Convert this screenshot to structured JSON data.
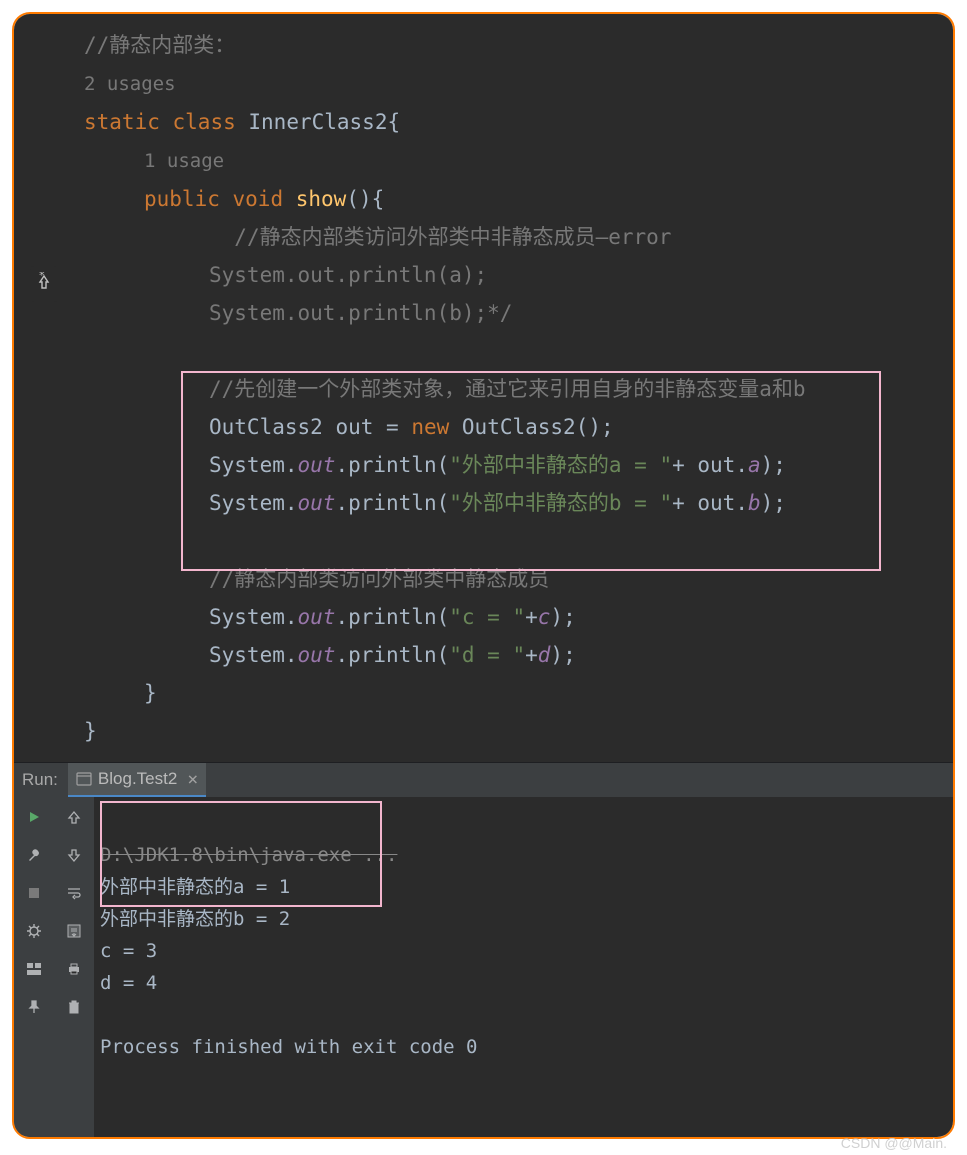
{
  "code": {
    "comment_top": "//静态内部类：",
    "usages_top": "2 usages",
    "class_decl": {
      "kw_static": "static",
      "kw_class": "class",
      "name": "InnerClass2",
      "brace": "{"
    },
    "usages_method": "1 usage",
    "method_decl": {
      "kw_public": "public",
      "kw_void": "void",
      "name": "show",
      "parens": "()",
      "brace": "{"
    },
    "comment_err": "//静态内部类访问外部类中非静态成员—error",
    "err_line1": "System.out.println(a);",
    "err_line2": "System.out.println(b);*/",
    "comment_box": "//先创建一个外部类对象，通过它来引用自身的非静态变量a和b",
    "create_line": {
      "type": "OutClass2",
      "var": "out",
      "eq": " = ",
      "kw_new": "new",
      "ctor": " OutClass2();"
    },
    "print_a": {
      "pre": "System.",
      "out": "out",
      "mid": ".println(",
      "str": "\"外部中非静态的a = \"",
      "plus": "+ out.",
      "field": "a",
      "end": ");"
    },
    "print_b": {
      "pre": "System.",
      "out": "out",
      "mid": ".println(",
      "str": "\"外部中非静态的b = \"",
      "plus": "+ out.",
      "field": "b",
      "end": ");"
    },
    "comment_static": "//静态内部类访问外部类中静态成员",
    "print_c": {
      "pre": "System.",
      "out": "out",
      "mid": ".println(",
      "str": "\"c = \"",
      "plus": "+",
      "field": "c",
      "end": ");"
    },
    "print_d": {
      "pre": "System.",
      "out": "out",
      "mid": ".println(",
      "str": "\"d = \"",
      "plus": "+",
      "field": "d",
      "end": ");"
    },
    "brace_close": "}"
  },
  "run": {
    "label": "Run:",
    "tab": "Blog.Test2",
    "cmd": "D:\\JDK1.8\\bin\\java.exe ...",
    "out1": "外部中非静态的a = 1",
    "out2": "外部中非静态的b = 2",
    "out3": "c = 3",
    "out4": "d = 4",
    "exit": "Process finished with exit code 0"
  },
  "watermark": "CSDN @@Main."
}
